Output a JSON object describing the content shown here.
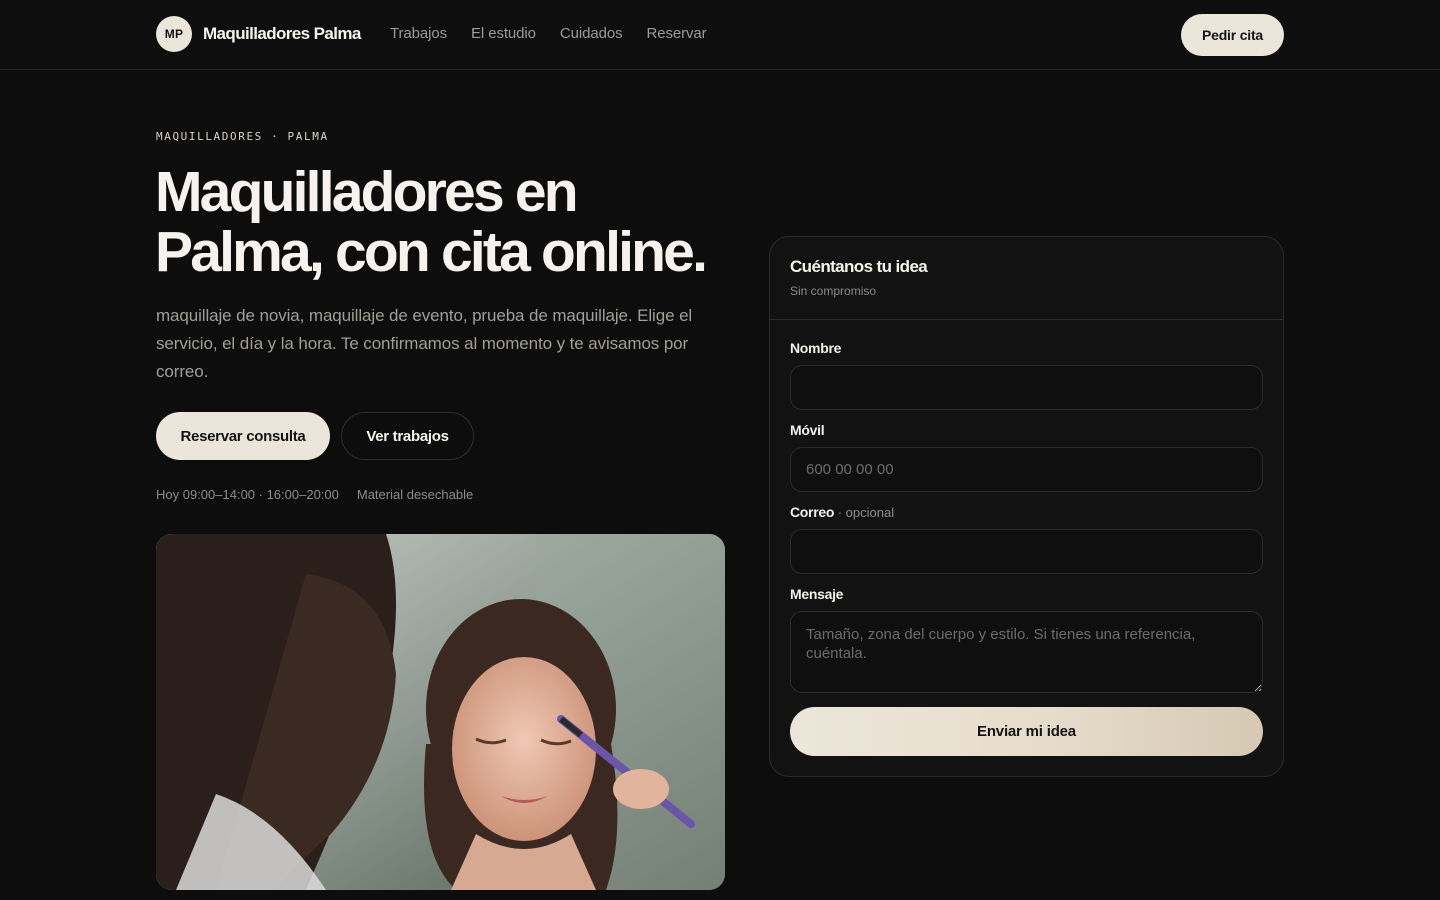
{
  "header": {
    "logo_initials": "MP",
    "brand_name": "Maquilladores Palma",
    "nav": [
      "Trabajos",
      "El estudio",
      "Cuidados",
      "Reservar"
    ],
    "cta": "Pedir cita"
  },
  "hero": {
    "eyebrow": "MAQUILLADORES · PALMA",
    "title_line1": "Maquilladores en",
    "title_line2": "Palma, con cita online.",
    "description": "maquillaje de novia, maquillaje de evento, prueba de maquillaje. Elige el servicio, el día y la hora. Te confirmamos al momento y te avisamos por correo.",
    "primary_button": "Reservar consulta",
    "secondary_button": "Ver trabajos",
    "hours": "Hoy 09:00–14:00 · 16:00–20:00",
    "feature": "Material desechable"
  },
  "form": {
    "title": "Cuéntanos tu idea",
    "subtitle": "Sin compromiso",
    "name_label": "Nombre",
    "name_value": "",
    "phone_label": "Móvil",
    "phone_placeholder": "600 00 00 00",
    "email_label": "Correo",
    "email_optional": " · opcional",
    "email_value": "",
    "message_label": "Mensaje",
    "message_placeholder": "Tamaño, zona del cuerpo y estilo. Si tienes una referencia, cuéntala.",
    "submit": "Enviar mi idea"
  },
  "colors": {
    "background": "#0d0d0d",
    "accent": "#ece6da",
    "muted_text": "#9c9a96"
  }
}
